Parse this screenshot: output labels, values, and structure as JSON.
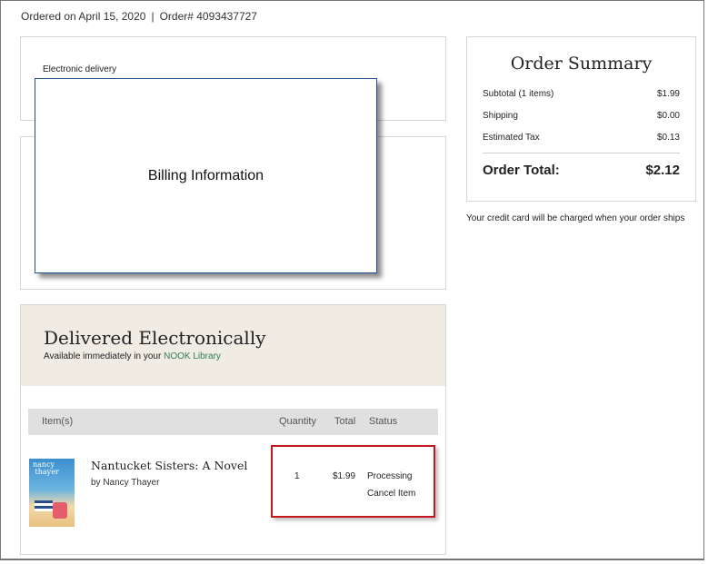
{
  "order_meta": {
    "ordered_on": "Ordered on April 15, 2020",
    "separator": "|",
    "order_number": "Order# 4093437727"
  },
  "delivery_box": {
    "label": "Electronic delivery"
  },
  "billing_overlay": {
    "label": "Billing Information"
  },
  "delivered": {
    "title": "Delivered Electronically",
    "subtitle_prefix": "Available immediately in your ",
    "library_link": "NOOK Library",
    "columns": [
      "Item(s)",
      "Quantity",
      "Total",
      "Status"
    ],
    "items": [
      {
        "cover_text": "nancy thayer nantucket sisters",
        "title": "Nantucket Sisters: A Novel",
        "author": "by Nancy Thayer",
        "quantity": "1",
        "total": "$1.99",
        "status": "Processing",
        "action": "Cancel Item"
      }
    ]
  },
  "summary": {
    "title": "Order Summary",
    "rows": [
      {
        "label": "Subtotal (1 items)",
        "value": "$1.99"
      },
      {
        "label": "Shipping",
        "value": "$0.00"
      },
      {
        "label": "Estimated Tax",
        "value": "$0.13"
      }
    ],
    "total_label": "Order Total:",
    "total_value": "$2.12",
    "note": "Your credit card will be charged when your order ships"
  },
  "colors": {
    "link_green": "#2e7d4f",
    "highlight_red": "#c4161c",
    "overlay_border": "#1f4e8c",
    "header_beige": "#f0ece4"
  }
}
